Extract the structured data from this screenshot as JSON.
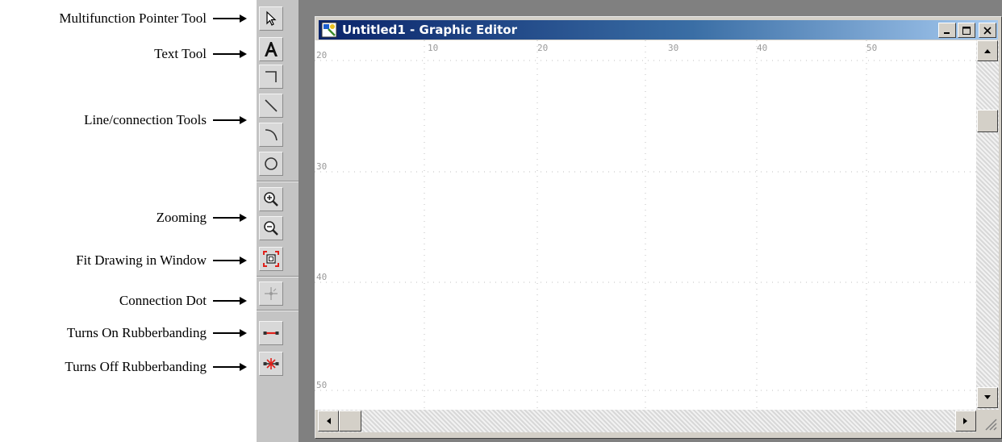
{
  "annotations": [
    {
      "label": "Multifunction Pointer Tool"
    },
    {
      "label": "Text Tool"
    },
    {
      "label": "Line/connection Tools"
    },
    {
      "label": "Zooming"
    },
    {
      "label": "Fit Drawing in Window"
    },
    {
      "label": "Connection Dot"
    },
    {
      "label": "Turns On Rubberbanding"
    },
    {
      "label": "Turns Off Rubberbanding"
    }
  ],
  "toolbar": {
    "tools": [
      {
        "name": "pointer-tool",
        "icon": "pointer-arrow-icon"
      },
      {
        "name": "text-tool",
        "icon": "text-a-icon"
      },
      {
        "name": "orthogonal-line-tool",
        "icon": "corner-line-icon"
      },
      {
        "name": "straight-line-tool",
        "icon": "diagonal-line-icon"
      },
      {
        "name": "arc-line-tool",
        "icon": "arc-line-icon"
      },
      {
        "name": "circle-tool",
        "icon": "circle-icon"
      },
      {
        "name": "zoom-in-tool",
        "icon": "zoom-in-icon"
      },
      {
        "name": "zoom-out-tool",
        "icon": "zoom-out-icon"
      },
      {
        "name": "fit-window-tool",
        "icon": "fit-window-icon"
      },
      {
        "name": "connection-dot-tool",
        "icon": "connection-dot-icon"
      },
      {
        "name": "rubberband-on-tool",
        "icon": "rubberband-on-icon"
      },
      {
        "name": "rubberband-off-tool",
        "icon": "rubberband-off-icon"
      }
    ]
  },
  "window": {
    "title": "Untitled1 - Graphic Editor",
    "title_icon": "graphic-editor-app-icon",
    "controls": [
      "minimize",
      "maximize",
      "close"
    ],
    "title_gradient": [
      "#0a246a",
      "#a6caf0"
    ]
  },
  "canvas": {
    "ruler_top": [
      "10",
      "20",
      "30",
      "40",
      "50"
    ],
    "ruler_left": [
      "20",
      "30",
      "40",
      "50"
    ],
    "grid": true
  },
  "colors": {
    "toolbar_bg": "#c4c4c4",
    "desktop_bg": "#808080",
    "rubberband_red": "#e0201a"
  }
}
